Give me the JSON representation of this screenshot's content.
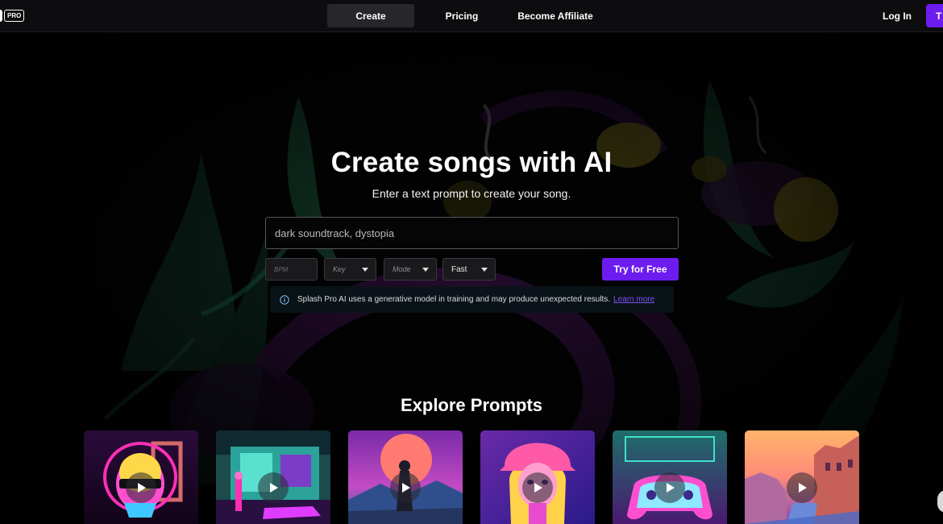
{
  "header": {
    "logo_badge": "PRO",
    "nav": [
      {
        "label": "Create",
        "active": true
      },
      {
        "label": "Pricing",
        "active": false
      },
      {
        "label": "Become Affiliate",
        "active": false
      }
    ],
    "login_label": "Log In",
    "cta_label": "T"
  },
  "hero": {
    "title": "Create songs with AI",
    "subtitle": "Enter a text prompt to create your song.",
    "prompt_placeholder": "dark soundtrack, dystopia",
    "bpm_placeholder": "BPM",
    "key_label": "Key",
    "mode_label": "Mode",
    "speed_label": "Fast",
    "submit_label": "Try for Free",
    "notice_text": "Splash Pro AI uses a generative model in training and may produce unexpected results.",
    "notice_link": "Learn more"
  },
  "explore": {
    "title": "Explore Prompts",
    "cards": [
      {
        "icon": "play-icon"
      },
      {
        "icon": "play-icon"
      },
      {
        "icon": "play-icon"
      },
      {
        "icon": "play-icon"
      },
      {
        "icon": "play-icon"
      },
      {
        "icon": "play-icon"
      }
    ]
  },
  "colors": {
    "accent": "#6d1cf0",
    "link": "#7d52f5",
    "background": "#000000",
    "header": "#0d0d10"
  }
}
